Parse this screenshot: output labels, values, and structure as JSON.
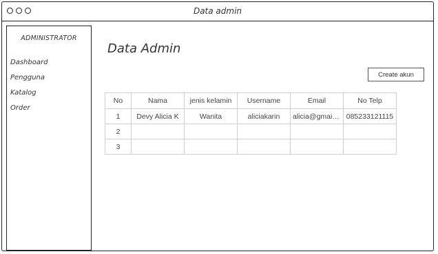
{
  "window": {
    "title": "Data admin"
  },
  "sidebar": {
    "header": "ADMINISTRATOR",
    "items": [
      {
        "label": "Dashboard"
      },
      {
        "label": "Pengguna"
      },
      {
        "label": "Katalog"
      },
      {
        "label": "Order"
      }
    ]
  },
  "main": {
    "title": "Data Admin",
    "create_button": "Create akun",
    "table": {
      "headers": [
        "No",
        "Nama",
        "jenis kelamin",
        "Username",
        "Email",
        "No Telp"
      ],
      "rows": [
        [
          "1",
          "Devy Alicia K",
          "Wanita",
          "aliciakarin",
          "alicia@gmail....",
          "085233121115"
        ],
        [
          "2",
          "",
          "",
          "",
          "",
          ""
        ],
        [
          "3",
          "",
          "",
          "",
          "",
          ""
        ]
      ]
    }
  }
}
